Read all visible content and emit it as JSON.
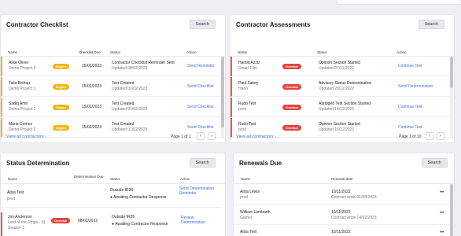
{
  "checklist": {
    "title": "Contractor Checklist",
    "search_label": "Search",
    "columns": [
      "Name",
      "Checklist Due",
      "Status",
      "Action"
    ],
    "rows": [
      {
        "name": "Alice Oliver",
        "project": "Demo Project 2",
        "badge": "Urgent",
        "due": "15/02/2023",
        "status": "Contractor Checklist Reminder Sent",
        "updated": "Updated 08/02/2023",
        "action": "Send Reminder"
      },
      {
        "name": "Talia Bishop",
        "project": "Demo Project 1",
        "badge": "Urgent",
        "due": "15/02/2023",
        "status": "Test Created",
        "updated": "Updated 01/02/2023",
        "action": "Send Checklist"
      },
      {
        "name": "Sadiq Amir",
        "project": "Demo Project 2",
        "badge": "Urgent",
        "due": "15/02/2023",
        "status": "Test Created",
        "updated": "Updated 01/02/2023",
        "action": "Send Checklist"
      },
      {
        "name": "Maria Gomez",
        "project": "Demo Project 2",
        "badge": "Urgent",
        "due": "15/02/2023",
        "status": "Test Created",
        "updated": "Updated 01/02/2023",
        "action": "Send Checklist"
      }
    ],
    "view_all": "View all contractors ›",
    "pager": "Page 1 of 1"
  },
  "assessments": {
    "title": "Contractor Assessments",
    "search_label": "Search",
    "columns": [
      "Name",
      "Status",
      "Action"
    ],
    "rows": [
      {
        "name": "Hamid Azziz",
        "sub": "Dwarf Film",
        "badge": "Overdue",
        "status": "Opinion Section Started",
        "updated": "Updated 07/11/2022",
        "action": "Continue Test"
      },
      {
        "name": "Paul Sakey",
        "sub": "Harln",
        "badge": "Overdue",
        "status": "Advisory Status Determination",
        "updated": "Updated 28/11/2022",
        "action": "Send Determination"
      },
      {
        "name": "Rudo Test",
        "sub": "prod",
        "badge": "Overdue",
        "status": "Abridged Test Section Started",
        "updated": "Updated 16/12/2021",
        "action": "Continue Test"
      },
      {
        "name": "Rudo Test",
        "sub": "prod",
        "badge": "Overdue",
        "status": "Opinion Section Started",
        "updated": "Updated 16/12/2021",
        "action": "Continue Test"
      }
    ],
    "view_all": "View all contractors ›",
    "pager": "Page 1 of 10"
  },
  "status_det": {
    "title": "Status Determination",
    "search_label": "Search",
    "columns": [
      "Name",
      "Determination Due",
      "Status",
      "Action"
    ],
    "rows": [
      {
        "name": "Ailsa Test",
        "sub": "prod",
        "badge": "",
        "due": "",
        "status": "Outside IR35",
        "status2": "● Awaiting Contractor Response",
        "action": "Send Determination Reminder"
      },
      {
        "name": "Jon Anderson",
        "sub": "Lord of the Rings - S| Season 1",
        "badge": "Overdue",
        "due": "08/02/2022",
        "status": "Outside IR35",
        "status2": "● Awaiting Contractor Response",
        "action": "Review Determination"
      }
    ]
  },
  "renewals": {
    "title": "Renewals Due",
    "search_label": "Search",
    "columns": [
      "Name",
      "Renewal date"
    ],
    "rows": [
      {
        "name": "Ailsa Lewis",
        "sub": "prod",
        "date": "10/11/2022",
        "note": "Contract ends 01/08/2023"
      },
      {
        "name": "William Lambarth",
        "sub": "Gamel",
        "date": "10/11/2022",
        "note": "Contract ends 14/02/2023"
      },
      {
        "name": "Ailsa Test",
        "sub": "",
        "date": "10/11/2022",
        "note": ""
      }
    ]
  },
  "icons": {
    "prev": "chevron-left-icon",
    "next": "chevron-right-icon",
    "more": "more-dots-icon"
  },
  "colors": {
    "urgent": "#f2b417",
    "overdue": "#e0453c",
    "link": "#3d6fd6"
  }
}
